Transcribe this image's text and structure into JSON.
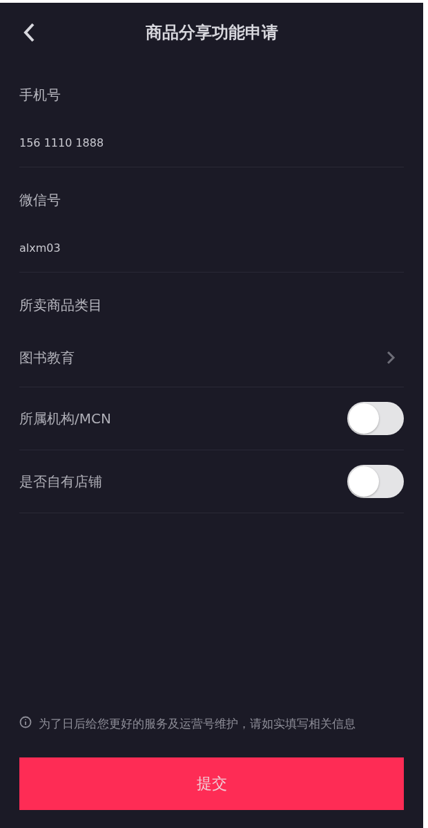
{
  "header": {
    "title": "商品分享功能申请"
  },
  "fields": [
    {
      "kind": "text",
      "label": "手机号",
      "value": "156 1110 1888"
    },
    {
      "kind": "text",
      "label": "微信号",
      "value": "alxm03"
    },
    {
      "kind": "select",
      "label": "所卖商品类目",
      "value": "图书教育"
    },
    {
      "kind": "toggle",
      "label": "所属机构/MCN",
      "on": false
    },
    {
      "kind": "toggle",
      "label": "是否自有店铺",
      "on": false
    }
  ],
  "notice": "为了日后给您更好的服务及运营号维护，请如实填写相关信息",
  "submit": "提交"
}
